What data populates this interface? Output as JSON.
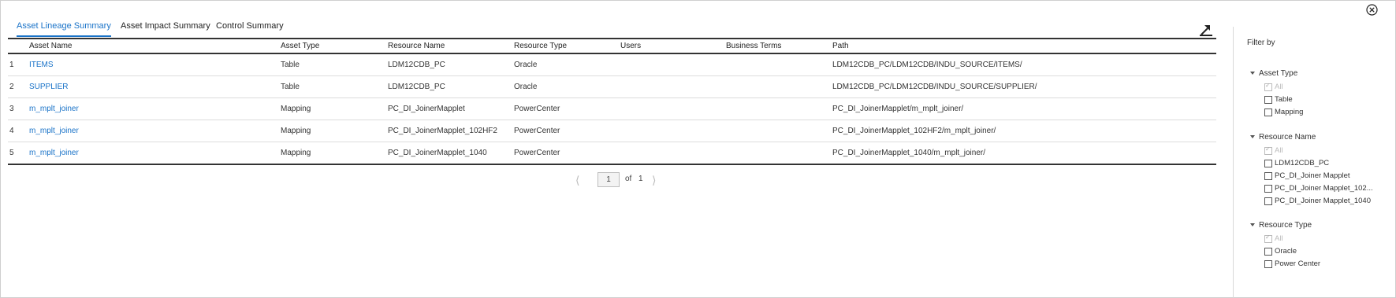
{
  "tabs": [
    "Asset Lineage Summary",
    "Asset Impact Summary",
    "Control Summary"
  ],
  "table": {
    "columns": [
      "Asset Name",
      "Asset Type",
      "Resource Name",
      "Resource Type",
      "Users",
      "Business Terms",
      "Path"
    ],
    "rows": [
      {
        "num": "1",
        "asset_name": "ITEMS",
        "asset_type": "Table",
        "resource_name": "LDM12CDB_PC",
        "resource_type": "Oracle",
        "users": "",
        "business_terms": "",
        "path": "LDM12CDB_PC/LDM12CDB/INDU_SOURCE/ITEMS/"
      },
      {
        "num": "2",
        "asset_name": "SUPPLIER",
        "asset_type": "Table",
        "resource_name": "LDM12CDB_PC",
        "resource_type": "Oracle",
        "users": "",
        "business_terms": "",
        "path": "LDM12CDB_PC/LDM12CDB/INDU_SOURCE/SUPPLIER/"
      },
      {
        "num": "3",
        "asset_name": "m_mplt_joiner",
        "asset_type": "Mapping",
        "resource_name": "PC_DI_JoinerMapplet",
        "resource_type": "PowerCenter",
        "users": "",
        "business_terms": "",
        "path": "PC_DI_JoinerMapplet/m_mplt_joiner/"
      },
      {
        "num": "4",
        "asset_name": "m_mplt_joiner",
        "asset_type": "Mapping",
        "resource_name": "PC_DI_JoinerMapplet_102HF2",
        "resource_type": "PowerCenter",
        "users": "",
        "business_terms": "",
        "path": "PC_DI_JoinerMapplet_102HF2/m_mplt_joiner/"
      },
      {
        "num": "5",
        "asset_name": "m_mplt_joiner",
        "asset_type": "Mapping",
        "resource_name": "PC_DI_JoinerMapplet_1040",
        "resource_type": "PowerCenter",
        "users": "",
        "business_terms": "",
        "path": "PC_DI_JoinerMapplet_1040/m_mplt_joiner/"
      }
    ]
  },
  "pager": {
    "current": "1",
    "of_label": "of",
    "total": "1"
  },
  "filter": {
    "title": "Filter by",
    "groups": [
      {
        "title": "Asset Type",
        "options": [
          "All",
          "Table",
          "Mapping"
        ]
      },
      {
        "title": "Resource Name",
        "options": [
          "All",
          "LDM12CDB_PC",
          "PC_DI_Joiner Mapplet",
          "PC_DI_Joiner Mapplet_102...",
          "PC_DI_Joiner Mapplet_1040"
        ]
      },
      {
        "title": "Resource Type",
        "options": [
          "All",
          "Oracle",
          "Power Center"
        ]
      }
    ]
  },
  "icons": {
    "export": "export-icon",
    "close": "close-icon"
  },
  "colors": {
    "accent": "#1a73c8"
  }
}
